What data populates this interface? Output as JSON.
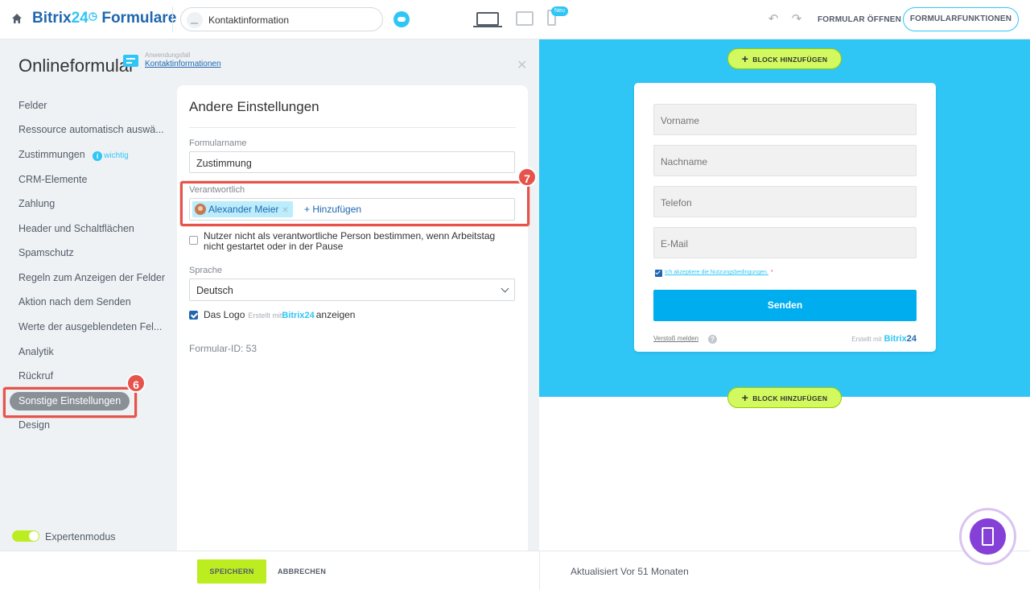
{
  "topbar": {
    "brand_prefix": "Bitrix",
    "brand_num": "24",
    "brand_suffix": "Formulare",
    "page_name": "Kontaktinformation",
    "new_badge": "Neu",
    "open_form": "FORMULAR ÖFFNEN",
    "form_functions": "FORMULARFUNKTIONEN"
  },
  "panel": {
    "title": "Onlineformular",
    "usecase_label": "Anwendungsfall",
    "usecase_link": "Kontaktinformationen",
    "nav_items": [
      "Felder",
      "Ressource automatisch auswä...",
      "Zustimmungen",
      "CRM-Elemente",
      "Zahlung",
      "Header und Schaltflächen",
      "Spamschutz",
      "Regeln zum Anzeigen der Felder",
      "Aktion nach dem Senden",
      "Werte der ausgeblendeten Fel...",
      "Analytik",
      "Rückruf",
      "Sonstige Einstellungen",
      "Design"
    ],
    "important_badge": "wichtig",
    "important_icon": "i",
    "expert_mode": "Expertenmodus"
  },
  "settings": {
    "title": "Andere Einstellungen",
    "form_name_label": "Formularname",
    "form_name_value": "Zustimmung",
    "responsible_label": "Verantwortlich",
    "responsible_user": "Alexander Meier",
    "add_link": "+ Hinzufügen",
    "workday_check_label": "Nutzer nicht als verantwortliche Person bestimmen, wenn Arbeitstag nicht gestartet oder in der Pause",
    "language_label": "Sprache",
    "language_value": "Deutsch",
    "logo_label_before": "Das Logo",
    "logo_made_with": "Erstellt mit",
    "logo_brand": "Bitrix24",
    "logo_label_after": "anzeigen",
    "form_id": "Formular-ID: 53"
  },
  "annotations": {
    "marker_6": "6",
    "marker_7": "7"
  },
  "footer": {
    "save": "SPEICHERN",
    "cancel": "ABBRECHEN",
    "updated": "Aktualisiert Vor 51 Monaten"
  },
  "preview": {
    "add_block": "BLOCK HINZUFÜGEN",
    "fields": [
      "Vorname",
      "Nachname",
      "Telefon",
      "E-Mail"
    ],
    "terms": "Ich akzeptiere die Nutzungsbedingungen.",
    "required_mark": "*",
    "submit": "Senden",
    "report": "Verstoß melden",
    "help": "?",
    "made_with": "Erstellt mit",
    "brand_a": "Bitrix",
    "brand_b": "24"
  },
  "colors": {
    "accent": "#2fc6f6",
    "brand_blue": "#2067b0",
    "save_green": "#bbed21",
    "highlight_red": "#e5534b",
    "fab_purple": "#8540d8"
  }
}
